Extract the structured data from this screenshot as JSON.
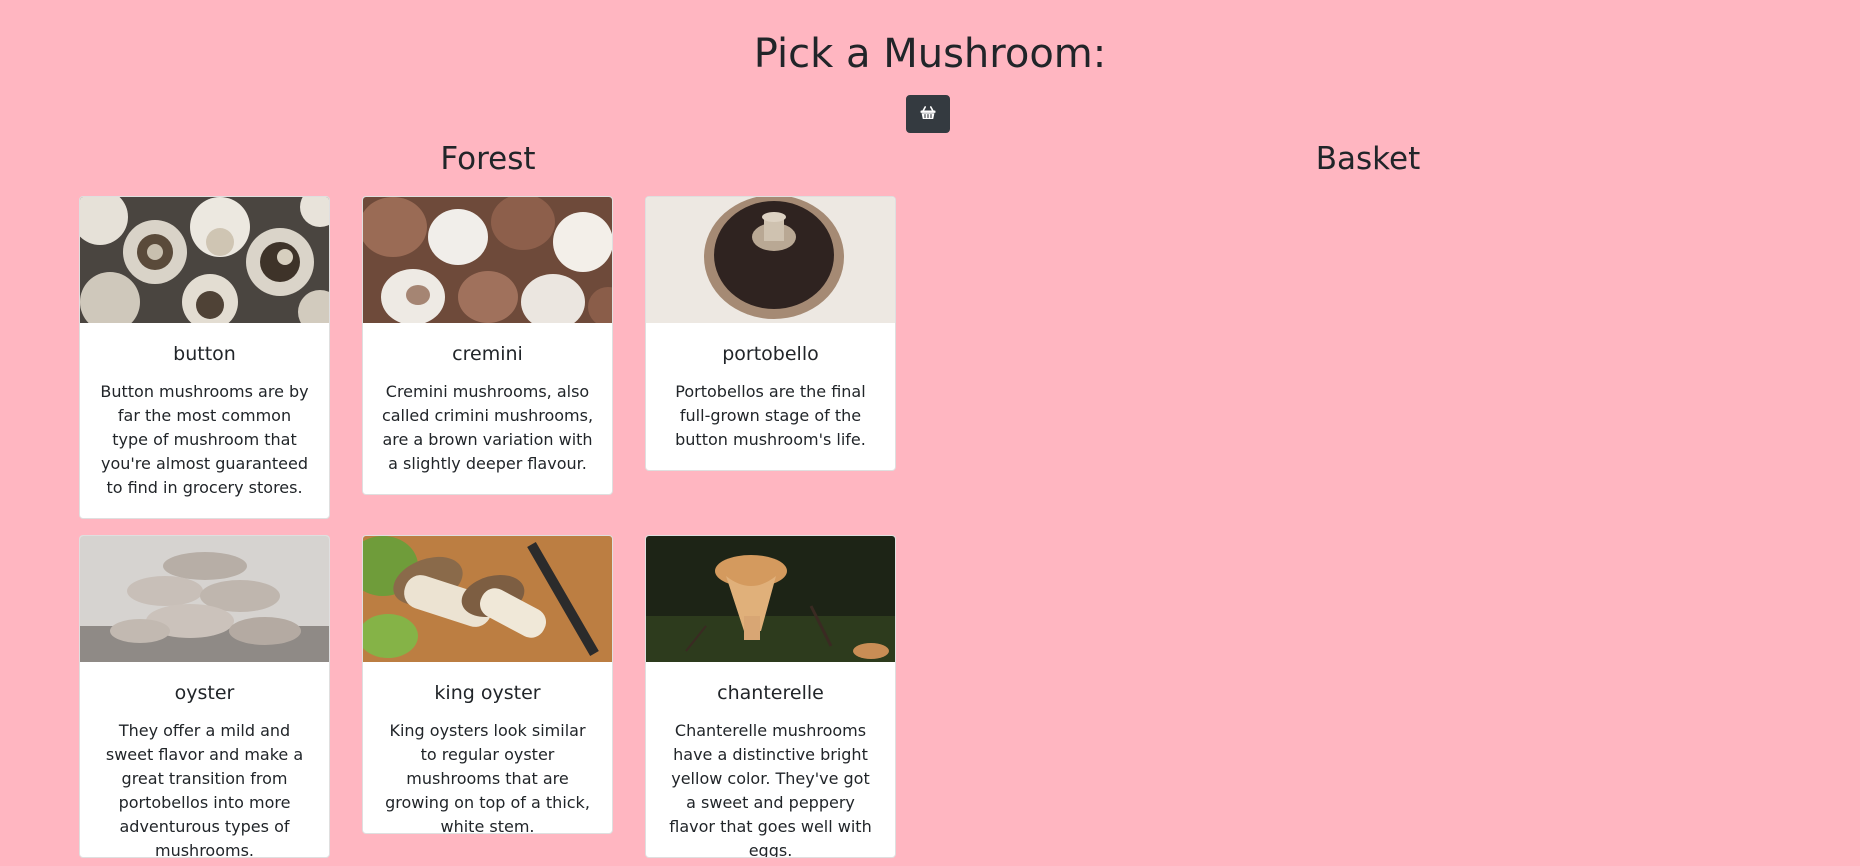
{
  "page": {
    "title": "Pick a Mushroom:",
    "basket_button_icon": "basket-icon"
  },
  "sections": {
    "forest_title": "Forest",
    "basket_title": "Basket"
  },
  "forest": {
    "cards": [
      {
        "name": "button",
        "description": "Button mushrooms are by far the most common type of mushroom that you're almost guaranteed to find in grocery stores.",
        "image": "button-mushroom-photo"
      },
      {
        "name": "cremini",
        "description": "Cremini mushrooms, also called crimini mushrooms, are a brown variation with a slightly deeper flavour.",
        "image": "cremini-mushroom-photo"
      },
      {
        "name": "portobello",
        "description": "Portobellos are the final full-grown stage of the button mushroom's life.",
        "image": "portobello-mushroom-photo"
      },
      {
        "name": "oyster",
        "description": "They offer a mild and sweet flavor and make a great transition from portobellos into more adventurous types of mushrooms.",
        "image": "oyster-mushroom-photo"
      },
      {
        "name": "king oyster",
        "description": "King oysters look similar to regular oyster mushrooms that are growing on top of a thick, white stem.",
        "image": "king-oyster-mushroom-photo"
      },
      {
        "name": "chanterelle",
        "description": "Chanterelle mushrooms have a distinctive bright yellow color. They've got a sweet and peppery flavor that goes well with eggs.",
        "image": "chanterelle-mushroom-photo"
      }
    ]
  },
  "colors": {
    "background": "#ffb6c1",
    "button_dark": "#343a40"
  }
}
